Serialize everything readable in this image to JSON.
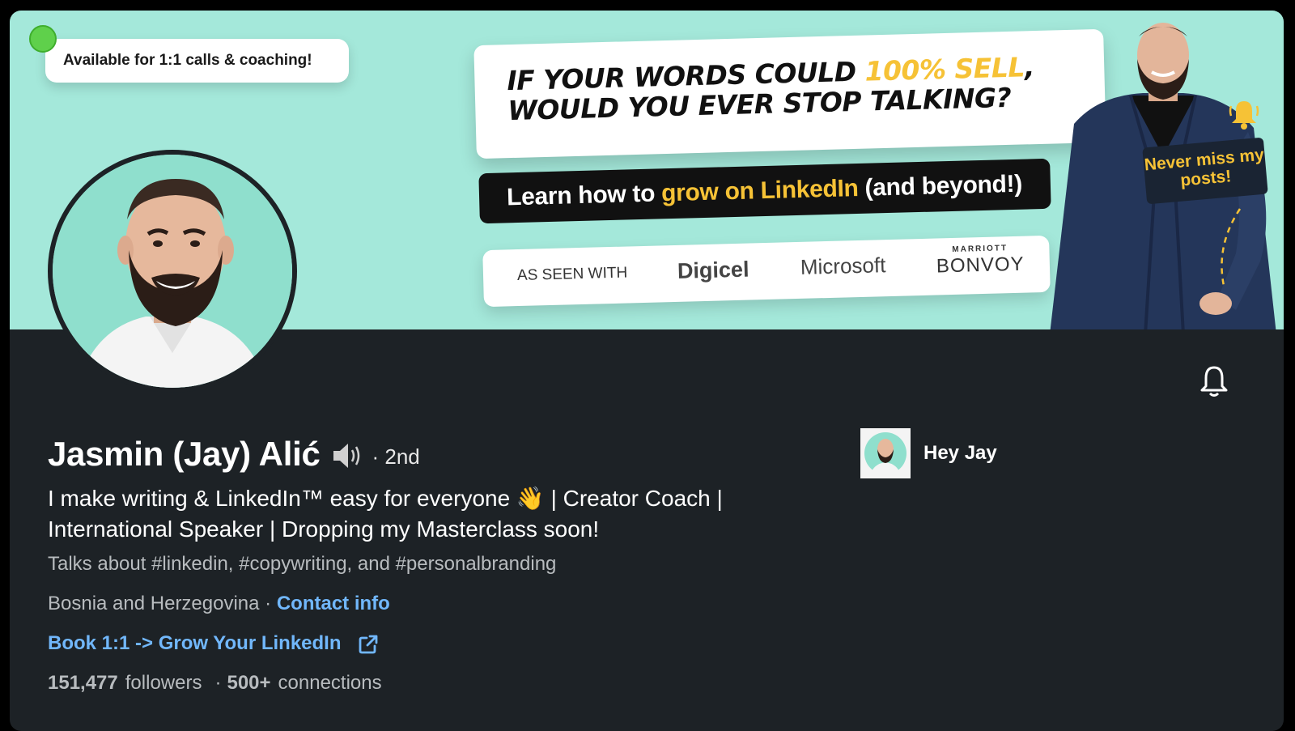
{
  "banner": {
    "availability": "Available for 1:1 calls & coaching!",
    "headline_line1_a": "IF YOUR WORDS COULD ",
    "headline_line1_highlight": "100% SELL",
    "headline_line1_b": ",",
    "headline_line2": "WOULD YOU EVER STOP TALKING?",
    "learn_a": "Learn how to",
    "learn_highlight": "grow on LinkedIn",
    "learn_b": "(and beyond!)",
    "seen_with": "AS SEEN WITH",
    "logos": {
      "digicel": "Digicel",
      "microsoft": "Microsoft",
      "marriott_small": "MARRIOTT",
      "marriott_big": "BONVOY"
    },
    "never_miss": "Never miss my posts!",
    "colors": {
      "banner_bg": "#a4e8da",
      "accent_yellow": "#f6c236"
    }
  },
  "profile": {
    "name": "Jasmin (Jay) Alić",
    "degree": "· 2nd",
    "headline": "I make writing & LinkedIn™ easy for everyone 👋 | Creator Coach | International Speaker | Dropping my Masterclass soon!",
    "talks_about": "Talks about #linkedin, #copywriting, and #personalbranding",
    "location": "Bosnia and Herzegovina",
    "location_sep": " · ",
    "contact_info": "Contact info",
    "book_link": "Book 1:1 -> Grow Your LinkedIn",
    "followers_count": "151,477",
    "followers_label": "followers",
    "stats_sep": "·",
    "connections_count": "500+",
    "connections_label": "connections"
  },
  "company": {
    "name": "Hey Jay"
  },
  "colors": {
    "card_bg": "#1d2226",
    "link": "#71b7fb"
  }
}
